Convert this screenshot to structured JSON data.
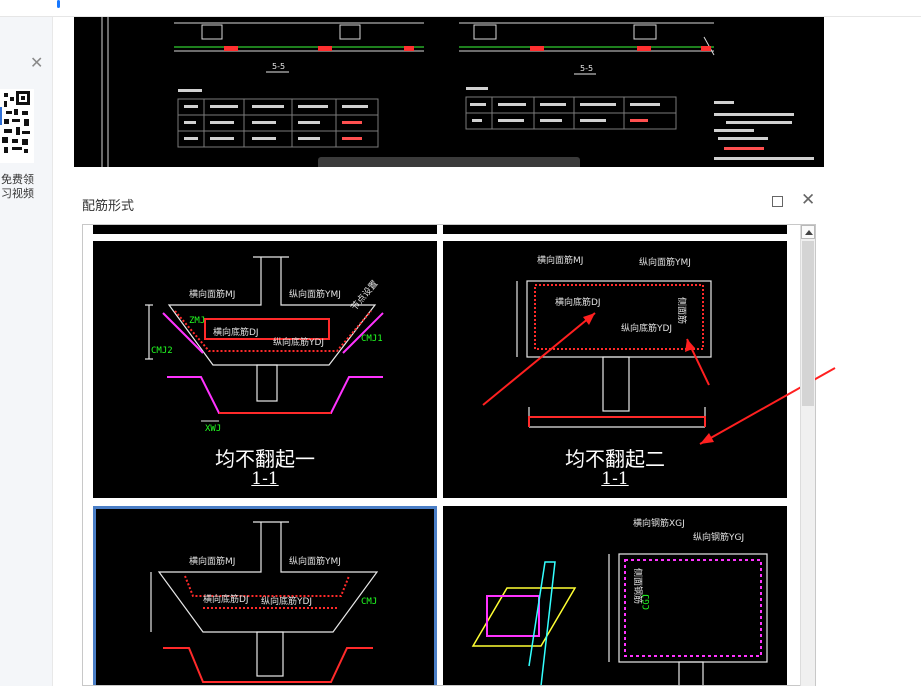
{
  "dialog": {
    "title": "配筋形式",
    "maximize_icon": "square-icon",
    "close_icon": "close-icon"
  },
  "promo": {
    "line1": "免费领",
    "line2": "习视频"
  },
  "cad_preview": {
    "section_left": "5-5",
    "section_right": "5-5"
  },
  "options": [
    {
      "label": "均不翻起一",
      "section": "1-1",
      "tags": {
        "top_h": "横向面筋MJ",
        "top_v": "纵向面筋YMJ",
        "bot_h": "横向底筋DJ",
        "bot_v": "纵向底筋YDJ",
        "cmj2": "CMJ2",
        "cmj1": "CMJ1",
        "xwj": "XWJ",
        "zmj": "ZMJ",
        "slope": "节点设置"
      }
    },
    {
      "label": "均不翻起二",
      "section": "1-1",
      "tags": {
        "top_h": "横向面筋MJ",
        "top_v": "纵向面筋YMJ",
        "bot_h": "横向底筋DJ",
        "bot_v": "纵向底筋YDJ",
        "side": "侧面筋"
      }
    },
    {
      "label": "",
      "section": "",
      "selected": true,
      "tags": {
        "top_h": "横向面筋MJ",
        "top_v": "纵向面筋YMJ",
        "bot_h": "横向底筋DJ",
        "bot_v": "纵向底筋YDJ",
        "cmj": "CMJ"
      }
    },
    {
      "label": "",
      "section": "",
      "tags": {
        "top_h": "横向钢筋XGJ",
        "top_v": "纵向钢筋YGJ",
        "side": "侧面钢筋",
        "cgj": "CGJ"
      }
    }
  ],
  "colors": {
    "accent": "#1677ff",
    "selected_border": "#4a7ec6",
    "arrow": "#ff2020",
    "rebar_red": "#ff2a2a",
    "rebar_magenta": "#ff33ff",
    "annotation_green": "#22ff22"
  }
}
